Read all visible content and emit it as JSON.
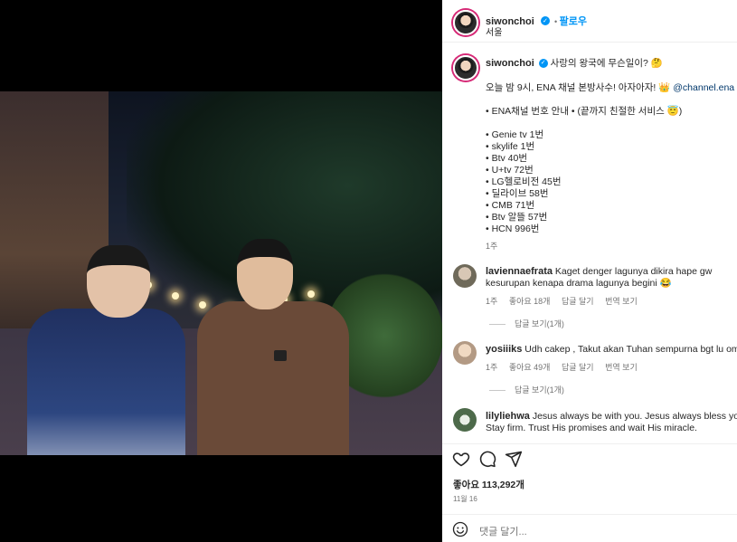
{
  "post": {
    "author": "siwonchoi",
    "follow_label": "팔로우",
    "location": "서울",
    "caption_first": "사랑의 왕국에 무슨일이? 🤔",
    "caption_line2": "오늘 밤 9시, ENA 채널 본방사수! 아자아자! 👑",
    "caption_mention": "@channel.ena",
    "caption_line3": "• ENA채널 번호 안내 • (끝까지 친절한 서비스 😇)",
    "channels": [
      "• Genie tv 1번",
      "• skylife 1번",
      "• Btv 40번",
      "• U+tv 72번",
      "• LG헬로비전 45번",
      "• 딜라이브 58번",
      "• CMB 71번",
      "• Btv 알뜰 57번",
      "• HCN 996번"
    ],
    "caption_age": "1주"
  },
  "comments": [
    {
      "user": "laviennaefrata",
      "text_l1": "Kaget denger lagunya dikira hape gw",
      "text_l2": "kesurupan kenapa drama lagunya begini 😂",
      "age": "1주",
      "likes": "좋아요 18개",
      "reply": "답글 달기",
      "translate": "번역 보기",
      "view_replies": "답글 보기(1개)"
    },
    {
      "user": "yosiiiks",
      "text_l1": "Udh cakep , Takut akan Tuhan sempurna bgt lu om 😱",
      "age": "1주",
      "likes": "좋아요 49개",
      "reply": "답글 달기",
      "translate": "번역 보기",
      "view_replies": "답글 보기(1개)"
    },
    {
      "user": "lilyliehwa",
      "text_l1": "Jesus always be with you. Jesus always bless you.",
      "text_l2": "Stay firm. Trust His promises and wait His miracle."
    }
  ],
  "actions": {
    "icons": [
      "heart-icon",
      "comment-icon",
      "share-icon"
    ],
    "likes": "좋아요 113,292개",
    "date": "11월 16"
  },
  "composer": {
    "placeholder": "댓글 달기..."
  },
  "colors": {
    "accent": "#0095f6",
    "mention": "#00376b",
    "muted": "#737373"
  }
}
